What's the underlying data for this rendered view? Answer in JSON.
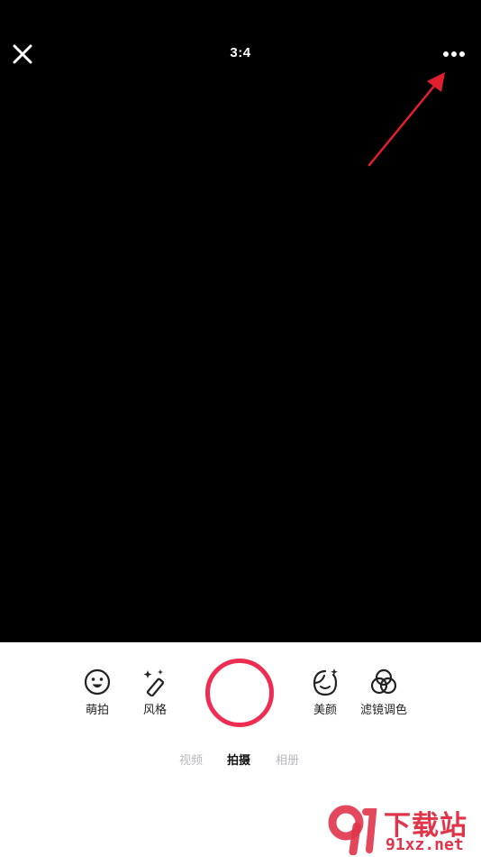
{
  "top_bar": {
    "close_icon": "close-icon",
    "aspect_ratio": "3:4",
    "more_icon": "more-horizontal-icon",
    "annotation_color": "#e21f2f"
  },
  "tools_left": [
    {
      "label": "萌拍",
      "icon": "smiley-face-icon"
    },
    {
      "label": "风格",
      "icon": "magic-wand-icon"
    }
  ],
  "tools_right": [
    {
      "label": "美颜",
      "icon": "beauty-face-icon"
    },
    {
      "label": "滤镜调色",
      "icon": "filter-circles-icon"
    }
  ],
  "shutter": {
    "color": "#ef2d52"
  },
  "modes": [
    {
      "label": "视频",
      "active": false
    },
    {
      "label": "拍摄",
      "active": true
    },
    {
      "label": "相册",
      "active": false
    }
  ],
  "watermark": {
    "title": "下载站",
    "url": "91xz.net",
    "logo_text": "9"
  }
}
